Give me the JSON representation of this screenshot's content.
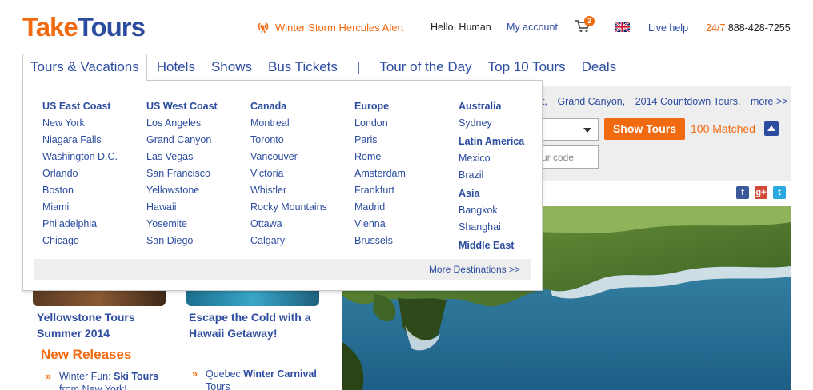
{
  "header": {
    "logo_part1": "Take",
    "logo_part2": "Tours",
    "alert": "Winter Storm Hercules Alert",
    "greeting": "Hello, Human",
    "my_account": "My account",
    "cart_count": "2",
    "live_help": "Live help",
    "phone_prefix": "24/7",
    "phone": "888-428-7255"
  },
  "nav": {
    "items": [
      "Tours & Vacations",
      "Hotels",
      "Shows",
      "Bus Tickets",
      "|",
      "Tour of the Day",
      "Top 10 Tours",
      "Deals"
    ]
  },
  "dropdown": {
    "columns": [
      {
        "heading": "US East Coast",
        "items": [
          "New York",
          "Niagara Falls",
          "Washington D.C.",
          "Orlando",
          "Boston",
          "Miami",
          "Philadelphia",
          "Chicago"
        ]
      },
      {
        "heading": "US West Coast",
        "items": [
          "Los Angeles",
          "Grand Canyon",
          "Las Vegas",
          "San Francisco",
          "Yellowstone",
          "Hawaii",
          "Yosemite",
          "San Diego"
        ]
      },
      {
        "heading": "Canada",
        "items": [
          "Montreal",
          "Toronto",
          "Vancouver",
          "Victoria",
          "Whistler",
          "Rocky Mountains",
          "Ottawa",
          "Calgary"
        ]
      },
      {
        "heading": "Europe",
        "items": [
          "London",
          "Paris",
          "Rome",
          "Amsterdam",
          "Frankfurt",
          "Madrid",
          "Vienna",
          "Brussels"
        ]
      }
    ],
    "col5": {
      "australia": "Australia",
      "sydney": "Sydney",
      "latin_america": "Latin America",
      "mexico": "Mexico",
      "brazil": "Brazil",
      "asia": "Asia",
      "bangkok": "Bangkok",
      "shanghai": "Shanghai",
      "middle_east": "Middle East"
    },
    "more": "More Destinations >>"
  },
  "search": {
    "links": [
      "t,",
      "Grand Canyon,",
      "2014 Countdown Tours,",
      "more >>"
    ],
    "show_tours": "Show Tours",
    "matched": "100 Matched",
    "code_placeholder": "ur code"
  },
  "social": {
    "facebook": "f",
    "google": "g+",
    "twitter": "t"
  },
  "features": {
    "cap1": "Yellowstone Tours Summer 2014",
    "cap2": "Escape the Cold with a Hawaii Getaway!",
    "new_releases": "New Releases",
    "promo1_pre": "Winter Fun: ",
    "promo1_bold": "Ski Tours",
    "promo1_post": " from New York!",
    "promo2_pre": "Quebec ",
    "promo2_bold": "Winter Carnival",
    "promo2_post": " Tours"
  }
}
